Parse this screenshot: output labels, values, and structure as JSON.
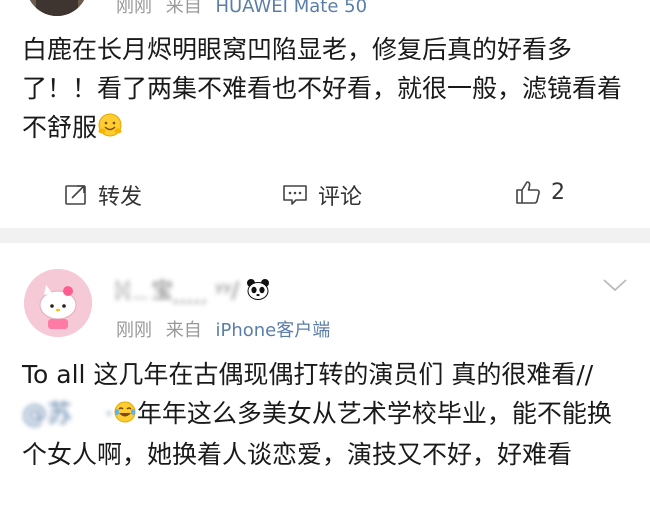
{
  "post1": {
    "meta_time": "刚刚",
    "meta_source_prefix": "来自",
    "meta_source": "HUAWEI Mate 50",
    "text": "白鹿在长月烬明眼窝凹陷显老，修复后真的好看多了！！看了两集不难看也不好看，就很一般，滤镜看着不舒服",
    "emoji": "hugging-face-emoji",
    "actions": {
      "forward": "转发",
      "comment": "评论",
      "like_count": "2"
    }
  },
  "post2": {
    "username_obscured": "ᛞ﹍宝 ̗ ̗ ̗ ̗ ̗ ʸʸ/",
    "username_suffix_emoji": "panda-emoji",
    "meta_time": "刚刚",
    "meta_source_prefix": "来自",
    "meta_source": "iPhone客户端",
    "text_part1": "To all 这几年在古偶现偶打转的演员们 真的很难看//",
    "mention_obscured": "@苏　 ·",
    "text_part2": "年年这么多美女从艺术学校毕业，能不能换个女人啊，她换着人谈恋爱，演技又不好，好难看",
    "emoji": "tears-of-joy-emoji"
  },
  "colors": {
    "link": "#5b7ea8",
    "meta": "#999999",
    "separator": "#f1f1f1"
  }
}
